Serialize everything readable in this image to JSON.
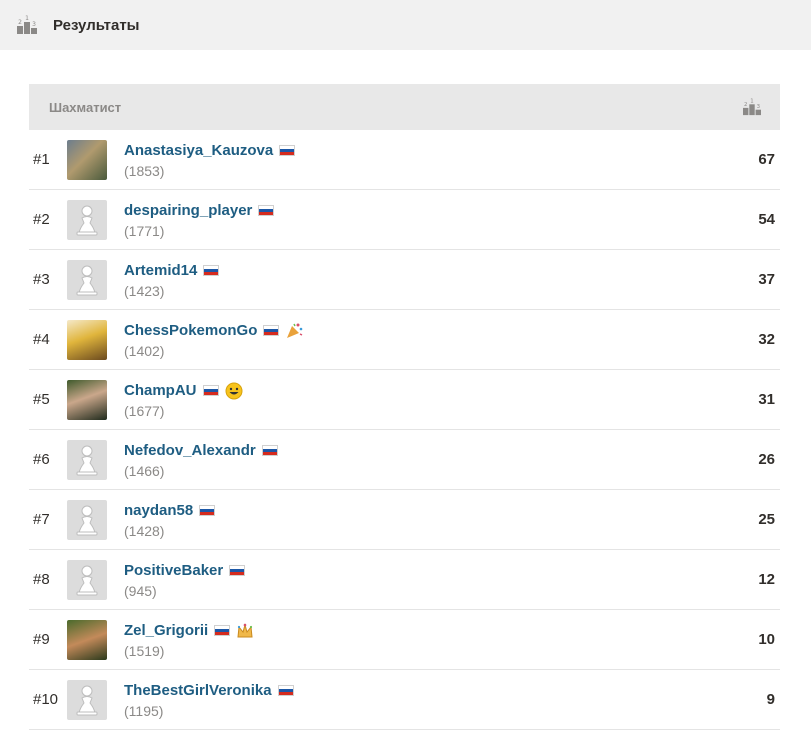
{
  "header": {
    "title": "Результаты",
    "icon": "podium-icon"
  },
  "table": {
    "column_player": "Шахматист",
    "column_score_icon": "podium-icon",
    "rows": [
      {
        "rank": "#1",
        "username": "Anastasiya_Kauzova",
        "rating": "(1853)",
        "score": "67",
        "avatar": "photo",
        "extra": ""
      },
      {
        "rank": "#2",
        "username": "despairing_player",
        "rating": "(1771)",
        "score": "54",
        "avatar": "pawn",
        "extra": ""
      },
      {
        "rank": "#3",
        "username": "Artemid14",
        "rating": "(1423)",
        "score": "37",
        "avatar": "pawn",
        "extra": ""
      },
      {
        "rank": "#4",
        "username": "ChessPokemonGo",
        "rating": "(1402)",
        "score": "32",
        "avatar": "photo",
        "extra": "party-popper-icon"
      },
      {
        "rank": "#5",
        "username": "ChampAU",
        "rating": "(1677)",
        "score": "31",
        "avatar": "photo",
        "extra": "smiley-icon"
      },
      {
        "rank": "#6",
        "username": "Nefedov_Alexandr",
        "rating": "(1466)",
        "score": "26",
        "avatar": "pawn",
        "extra": ""
      },
      {
        "rank": "#7",
        "username": "naydan58",
        "rating": "(1428)",
        "score": "25",
        "avatar": "pawn",
        "extra": ""
      },
      {
        "rank": "#8",
        "username": "PositiveBaker",
        "rating": "(945)",
        "score": "12",
        "avatar": "pawn",
        "extra": ""
      },
      {
        "rank": "#9",
        "username": "Zel_Grigorii",
        "rating": "(1519)",
        "score": "10",
        "avatar": "photo",
        "extra": "crown-icon"
      },
      {
        "rank": "#10",
        "username": "TheBestGirlVeronika",
        "rating": "(1195)",
        "score": "9",
        "avatar": "pawn",
        "extra": ""
      }
    ]
  },
  "colors": {
    "link": "#1e5d82",
    "muted": "#8b8987",
    "header_bg": "#e8e8e8",
    "topbar_bg": "#f1f1f1"
  }
}
